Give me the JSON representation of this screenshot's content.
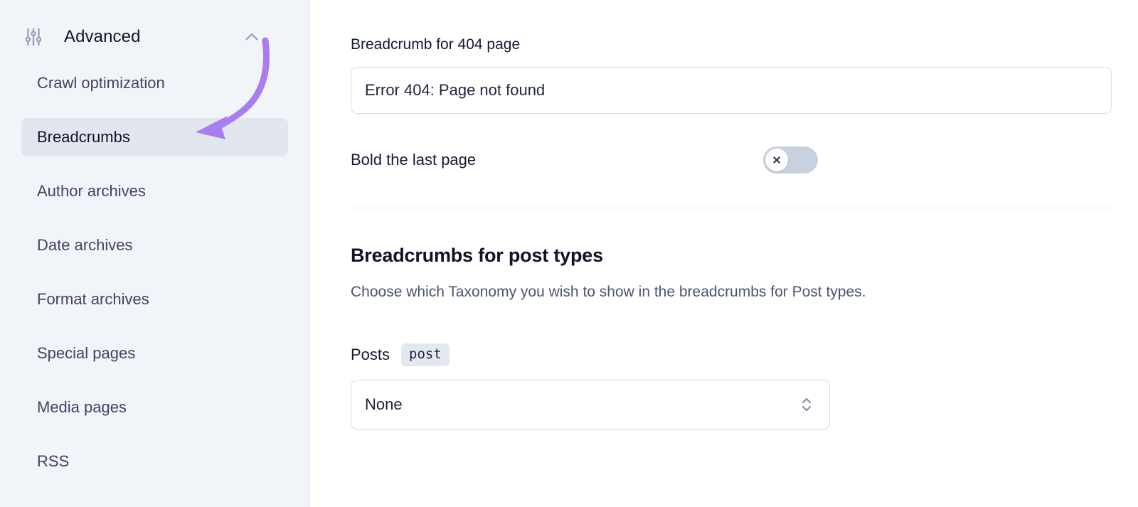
{
  "sidebar": {
    "icon": "sliders-icon",
    "title": "Advanced",
    "collapse_icon": "chevron-up-icon",
    "items": [
      {
        "label": "Crawl optimization",
        "active": false
      },
      {
        "label": "Breadcrumbs",
        "active": true
      },
      {
        "label": "Author archives",
        "active": false
      },
      {
        "label": "Date archives",
        "active": false
      },
      {
        "label": "Format archives",
        "active": false
      },
      {
        "label": "Special pages",
        "active": false
      },
      {
        "label": "Media pages",
        "active": false
      },
      {
        "label": "RSS",
        "active": false
      }
    ]
  },
  "main": {
    "breadcrumb_404": {
      "label": "Breadcrumb for 404 page",
      "value": "Error 404: Page not found",
      "placeholder": "Error 404: Page not found"
    },
    "bold_last_page": {
      "label": "Bold the last page",
      "state": "off",
      "state_icon": "close-icon"
    },
    "post_types": {
      "title": "Breadcrumbs for post types",
      "description": "Choose which Taxonomy you wish to show in the breadcrumbs for Post types.",
      "posts_label": "Posts",
      "posts_code": "post",
      "taxonomy_value": "None",
      "taxonomy_options": [
        "None"
      ]
    }
  },
  "annotation": {
    "type": "curved-arrow",
    "color": "#a97cf0",
    "points_from": "chevron-up-icon",
    "points_to": "sidebar-item-breadcrumbs"
  },
  "colors": {
    "sidebar_bg": "#f1f4f9",
    "active_item_bg": "#e2e6ef",
    "content_bg": "#ffffff",
    "border": "#d7dce9",
    "text_primary": "#121a32",
    "text_secondary": "#4a5473",
    "toggle_off_track": "#c9d0de",
    "accent_annotation": "#a97cf0"
  }
}
